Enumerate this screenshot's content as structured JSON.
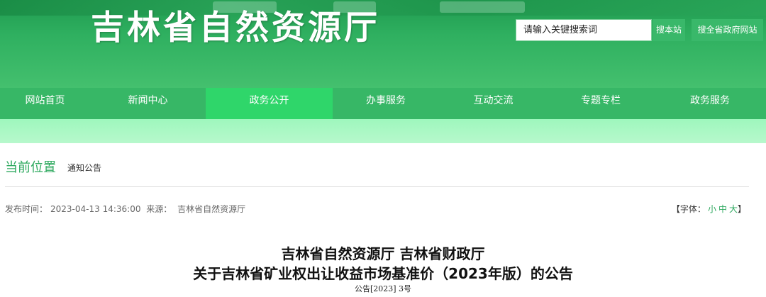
{
  "header": {
    "site_title": "吉林省自然资源厅",
    "search_placeholder": "请输入关键搜索词",
    "search_site_label": "搜本站",
    "search_all_label": "搜全省政府网站"
  },
  "nav": {
    "items": [
      "网站首页",
      "新闻中心",
      "政务公开",
      "办事服务",
      "互动交流",
      "专题专栏",
      "政务服务"
    ],
    "active_index": 2
  },
  "breadcrumb": {
    "title": "当前位置",
    "current": "通知公告"
  },
  "meta": {
    "publish_label": "发布时间：",
    "publish_time": "2023-04-13 14:36:00",
    "source_label": "来源：",
    "source": "吉林省自然资源厅"
  },
  "font_size": {
    "open": "【字体：",
    "small": "小",
    "medium": "中",
    "large": "大",
    "close": "】"
  },
  "article": {
    "title_line1": "吉林省自然资源厅 吉林省财政厅",
    "title_line2": "关于吉林省矿业权出让收益市场基准价（2023年版）的公告",
    "doc_number": "公告[2023] 3号"
  },
  "colors": {
    "header_green": "#2fb060",
    "nav_green": "#37b766",
    "nav_active": "#2fd66a",
    "band": "#9ef7bd",
    "accent": "#2ea95f"
  }
}
